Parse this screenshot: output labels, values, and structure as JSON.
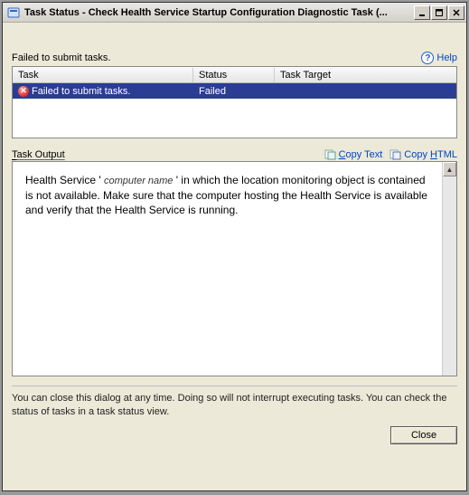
{
  "window": {
    "title": "Task Status - Check Health Service Startup Configuration Diagnostic Task (..."
  },
  "top": {
    "status_message": "Failed to submit tasks.",
    "help_label": "Help"
  },
  "grid": {
    "headers": {
      "task": "Task",
      "status": "Status",
      "target": "Task Target"
    },
    "row": {
      "task": "Failed to submit tasks.",
      "status": "Failed",
      "target": ""
    }
  },
  "output": {
    "label": "Task Output",
    "copy_text": "Copy Text",
    "copy_html": "Copy HTML",
    "body_prefix": "Health Service ' ",
    "body_placeholder": "computer name",
    "body_suffix": " ' in which the location monitoring object is contained is not available. Make sure that the computer hosting the Health Service is available and verify that the Health Service is running."
  },
  "footer": {
    "notice": "You can close this dialog at any time.  Doing so will not interrupt executing tasks.  You can check the status of tasks in a task status view.",
    "close_label": "Close"
  }
}
